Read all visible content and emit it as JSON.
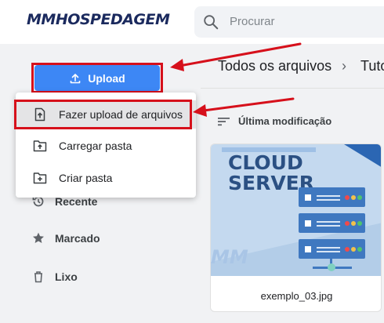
{
  "header": {
    "logo_text": "MMHOSPEDAGEM",
    "search_placeholder": "Procurar"
  },
  "sidebar": {
    "upload_label": "Upload",
    "menu": [
      {
        "label": "Fazer upload de arquivos",
        "icon": "file-upload-icon"
      },
      {
        "label": "Carregar pasta",
        "icon": "folder-upload-icon"
      },
      {
        "label": "Criar pasta",
        "icon": "folder-add-icon"
      }
    ],
    "items": [
      {
        "label": "Recente",
        "icon": "history-icon"
      },
      {
        "label": "Marcado",
        "icon": "star-icon"
      },
      {
        "label": "Lixo",
        "icon": "trash-icon"
      }
    ]
  },
  "main": {
    "breadcrumb": [
      "Todos os arquivos",
      "Tuto"
    ],
    "sort_label": "Última modificação",
    "files": [
      {
        "name": "exemplo_03.jpg",
        "thumb_title_1": "CLOUD",
        "thumb_title_2": "SERVER",
        "thumb_watermark": "MM"
      }
    ]
  },
  "colors": {
    "accent": "#3d87f5",
    "highlight": "#d6101b",
    "brand": "#1b2a5e"
  }
}
